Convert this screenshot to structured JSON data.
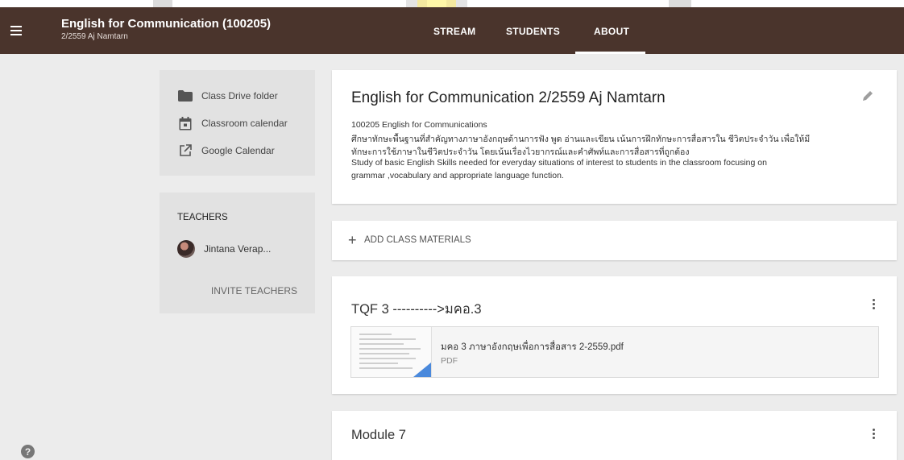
{
  "colors": {
    "header_bg": "#4a342c",
    "accent_blue": "#4a89dc",
    "page_bg": "#ececec",
    "watermark_yellow": "#fff7a8",
    "watermark_gray": "#dcdcdc"
  },
  "header": {
    "title": "English for Communication (100205)",
    "subtitle": "2/2559 Aj Namtarn",
    "menu_icon": "hamburger-menu-icon",
    "tabs": [
      {
        "label": "STREAM",
        "active": false
      },
      {
        "label": "STUDENTS",
        "active": false
      },
      {
        "label": "ABOUT",
        "active": true
      }
    ]
  },
  "sidebar": {
    "links": [
      {
        "label": "Class Drive folder",
        "icon": "folder-icon"
      },
      {
        "label": "Classroom calendar",
        "icon": "calendar-icon"
      },
      {
        "label": "Google Calendar",
        "icon": "open-in-new-icon"
      }
    ],
    "teachers_heading": "TEACHERS",
    "teacher_name": "Jintana Verap...",
    "invite_label": "INVITE TEACHERS",
    "help_icon": "help-icon"
  },
  "about": {
    "title": "English for Communication 2/2559 Aj Namtarn",
    "description_lines": [
      "100205 English for Communications",
      "ศึกษาทักษะพื้นฐานที่สำคัญทางภาษาอังกฤษด้านการฟัง พูด อ่านและเขียน เน้นการฝึกทักษะการสื่อสารใน ชีวิตประจำวัน เพื่อให้มี",
      "ทักษะการใช้ภาษาในชีวิตประจำวัน โดยเน้นเรื่องไวยากรณ์และคำศัพท์และการสื่อสารที่ถูกต้อง",
      "Study of basic English Skills needed for everyday situations of interest to students in the classroom focusing on",
      "grammar ,vocabulary and appropriate language function."
    ]
  },
  "add_materials": {
    "label": "ADD CLASS MATERIALS",
    "icon": "plus-icon"
  },
  "topics": [
    {
      "title": "TQF 3 ---------->มคอ.3",
      "attachment": {
        "name": "มคอ 3 ภาษาอังกฤษเพื่อการสื่อสาร 2-2559.pdf",
        "type": "PDF"
      }
    },
    {
      "title": "Module 7"
    }
  ]
}
